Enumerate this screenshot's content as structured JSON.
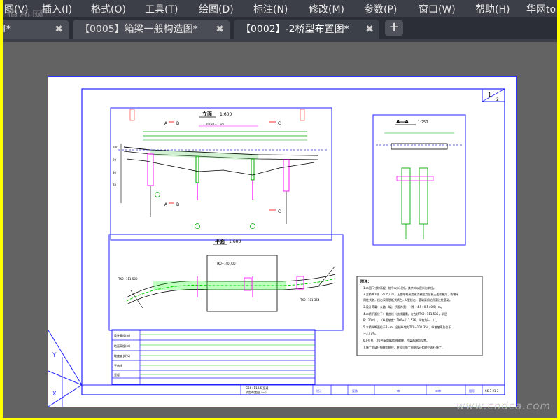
{
  "menubar": {
    "items": [
      "图(V)",
      "插入(I)",
      "格式(O)",
      "工具(T)",
      "绘图(D)",
      "标注(N)",
      "修改(M)",
      "参数(P)",
      "窗口(W)",
      "帮助(H)",
      "华网to"
    ]
  },
  "tabs": [
    {
      "label": "f*",
      "active": false
    },
    {
      "label": "【0005】箱梁一般构造图*",
      "active": false
    },
    {
      "label": "【0002】-2桥型布置图*",
      "active": true
    }
  ],
  "new_tab_label": "+",
  "close_glyph": "✖",
  "watermark_top": "道桥网",
  "watermark_bottom": "www.cndca.com",
  "drawing": {
    "elevation_title": "立面",
    "elevation_scale": "1:600",
    "plan_title": "平面",
    "plan_scale": "1:600",
    "section_title": "A—A",
    "section_scale": "1:250",
    "section_marks": [
      "A",
      "B",
      "C",
      "A",
      "B",
      "C"
    ],
    "notes_title": "附注：",
    "notes": [
      "1.本图尺寸除高程、桩号以米计外，其余均以厘米为单位。",
      "2.全桥共1联（2x35）m，上部结构采用现浇预应力混凝土连续箱梁，桥墩采",
      "  用柱式墩，桥台采用肋板式桥台，U型桥台，基础采用钻孔灌注桩基础。",
      "3.设计荷载：公路—I级；桥面净宽：（净—4.5+0.5+0.5）m。",
      "4.本桥平面位于：圆曲线（曲线要素，在左桥TK0+111.536，半径",
      "  R：20m），（纵面坡度：TK0+111.536，纵坡为i=...）。",
      "5.本桥纵断面位于R=m，全桥纵坡为TK0+101.354，纵坡坡率及位于",
      "  —3.47%。",
      "6.0号台、3号台采用80型伸缩缝，桥梁两端均设置。",
      "7.施工前请仔细核对桩位，桩号与施工图纸设计相符后再行施工。"
    ],
    "table_rows": [
      "设计高程(m)",
      "地面高程(m)",
      "坡度坡长(%)",
      "平曲线",
      "里程"
    ],
    "sheet_number": "1",
    "sheet_total": "2",
    "title_block": {
      "project": "G56+114.6 互通",
      "drawing_name": "桥型布置图（一）",
      "design_label": "设计",
      "review_label": "复核",
      "check_label": "审核",
      "sign_label_1": "一审",
      "sign_label_2": "二审",
      "sheet_label": "图号",
      "sheet_code": "S6-3-21-2"
    }
  }
}
